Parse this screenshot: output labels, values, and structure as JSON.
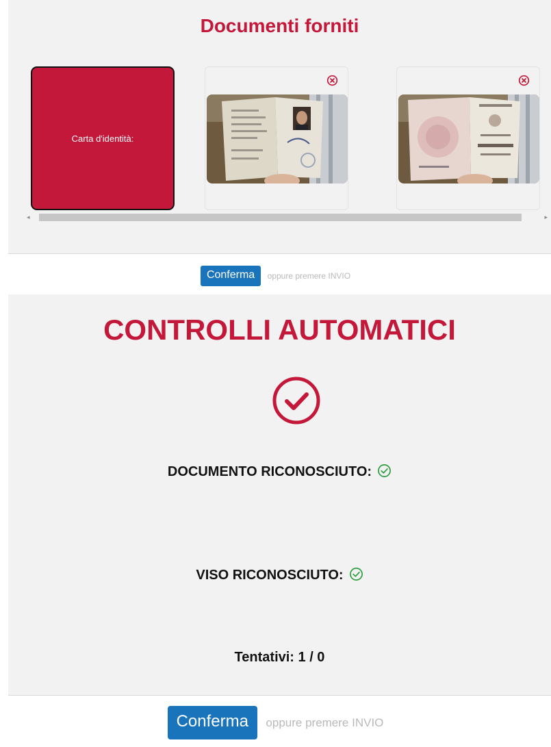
{
  "documents_section": {
    "title": "Documenti forniti",
    "selected_card_label": "Carta d'identità:"
  },
  "confirm_top": {
    "button_label": "Conferma",
    "hint": "oppure premere INVIO"
  },
  "automatic_checks": {
    "title": "CONTROLLI AUTOMATICI",
    "document_recognized_label": "DOCUMENTO RICONOSCIUTO:",
    "face_recognized_label": "VISO RICONOSCIUTO:",
    "attempts_label": "Tentativi: 1 / 0"
  },
  "confirm_bottom": {
    "button_label": "Conferma",
    "hint": "oppure premere INVIO"
  },
  "colors": {
    "accent_red": "#c4183b",
    "button_blue": "#1a74bc",
    "success_green": "#2e9e3e"
  },
  "icons": {
    "remove": "circle-x-icon",
    "big_check": "circle-check-icon",
    "ok": "circle-check-icon"
  }
}
